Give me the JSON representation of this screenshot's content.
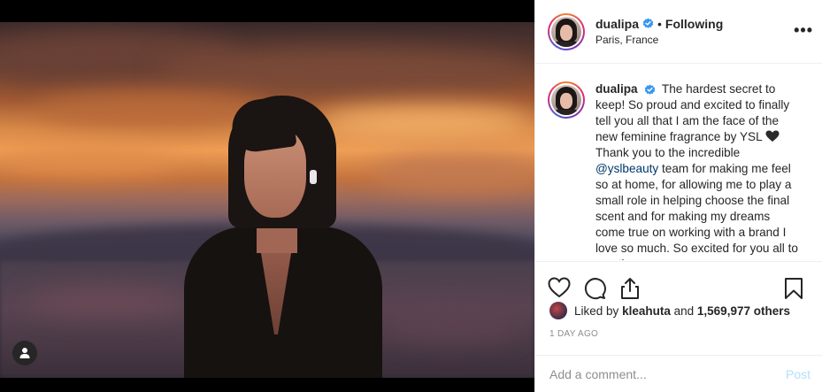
{
  "header": {
    "username": "dualipa",
    "separator": "•",
    "follow_status": "Following",
    "location": "Paris, France",
    "more_label": "•••"
  },
  "caption": {
    "username": "dualipa",
    "text_part1": "The hardest secret to keep! So proud and excited to finally tell you all that I am the face of the new feminine fragrance by YSL",
    "text_part2": "Thank you to the incredible",
    "mention": "@yslbeauty",
    "text_part3": "team for making me feel so at home, for allowing me to play a small role in helping choose the final scent and for making my dreams come true on working with a brand I love so much. So excited for you all to see the"
  },
  "likes": {
    "prefix": "Liked by",
    "liker": "kleahuta",
    "connector": "and",
    "count_text": "1,569,977 others"
  },
  "timestamp": "1 DAY AGO",
  "comment": {
    "placeholder": "Add a comment...",
    "post_label": "Post"
  },
  "colors": {
    "verified_blue": "#3897f0",
    "post_disabled": "#b2dffc",
    "muted_text": "#8e8e8e",
    "mention": "#00376b"
  },
  "icons": {
    "like": "heart-outline-icon",
    "comment": "speech-bubble-icon",
    "share": "share-upload-icon",
    "save": "bookmark-icon",
    "tag": "user-tag-icon",
    "verified": "verified-badge-icon",
    "more": "more-options-icon"
  }
}
